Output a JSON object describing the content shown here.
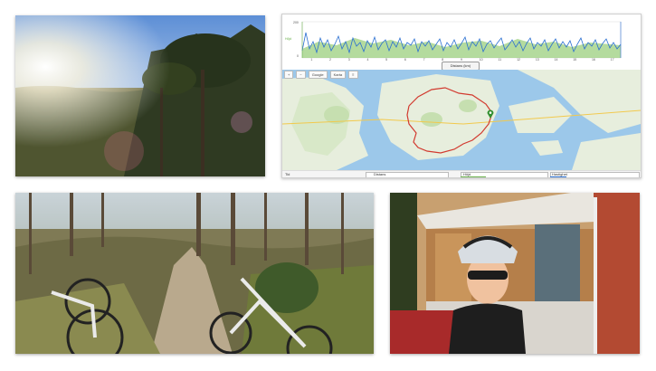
{
  "dashboard": {
    "chart": {
      "y_left_top": "200",
      "y_left_label": "Höjd",
      "y_left_bottom": "0",
      "x_ticks": [
        "1",
        "2",
        "3",
        "4",
        "5",
        "6",
        "7",
        "8",
        "9",
        "10",
        "11",
        "12",
        "13",
        "14",
        "15",
        "16",
        "17"
      ],
      "dropdown": "Distans (km)"
    },
    "map_toolbar": {
      "zoom_in": "+",
      "zoom_out": "−",
      "map_type_1": "Google",
      "map_type_2": "Karta",
      "layers": "≡"
    },
    "bottom": {
      "left_label": "Tid",
      "distance_label": "Distans",
      "height_label": "Höjd",
      "speed_label": "Hastighet"
    },
    "colors": {
      "speed": "#2a6fd1",
      "height": "#6ab04c",
      "route": "#d23a2f",
      "water": "#9cc8ea",
      "land": "#e7eedd",
      "marker": "#2f8f2f"
    }
  },
  "photos": [
    {
      "name": "forest-sunset-photo"
    },
    {
      "name": "mountain-bikes-trail-photo"
    },
    {
      "name": "cyclist-selfie-photo"
    }
  ]
}
